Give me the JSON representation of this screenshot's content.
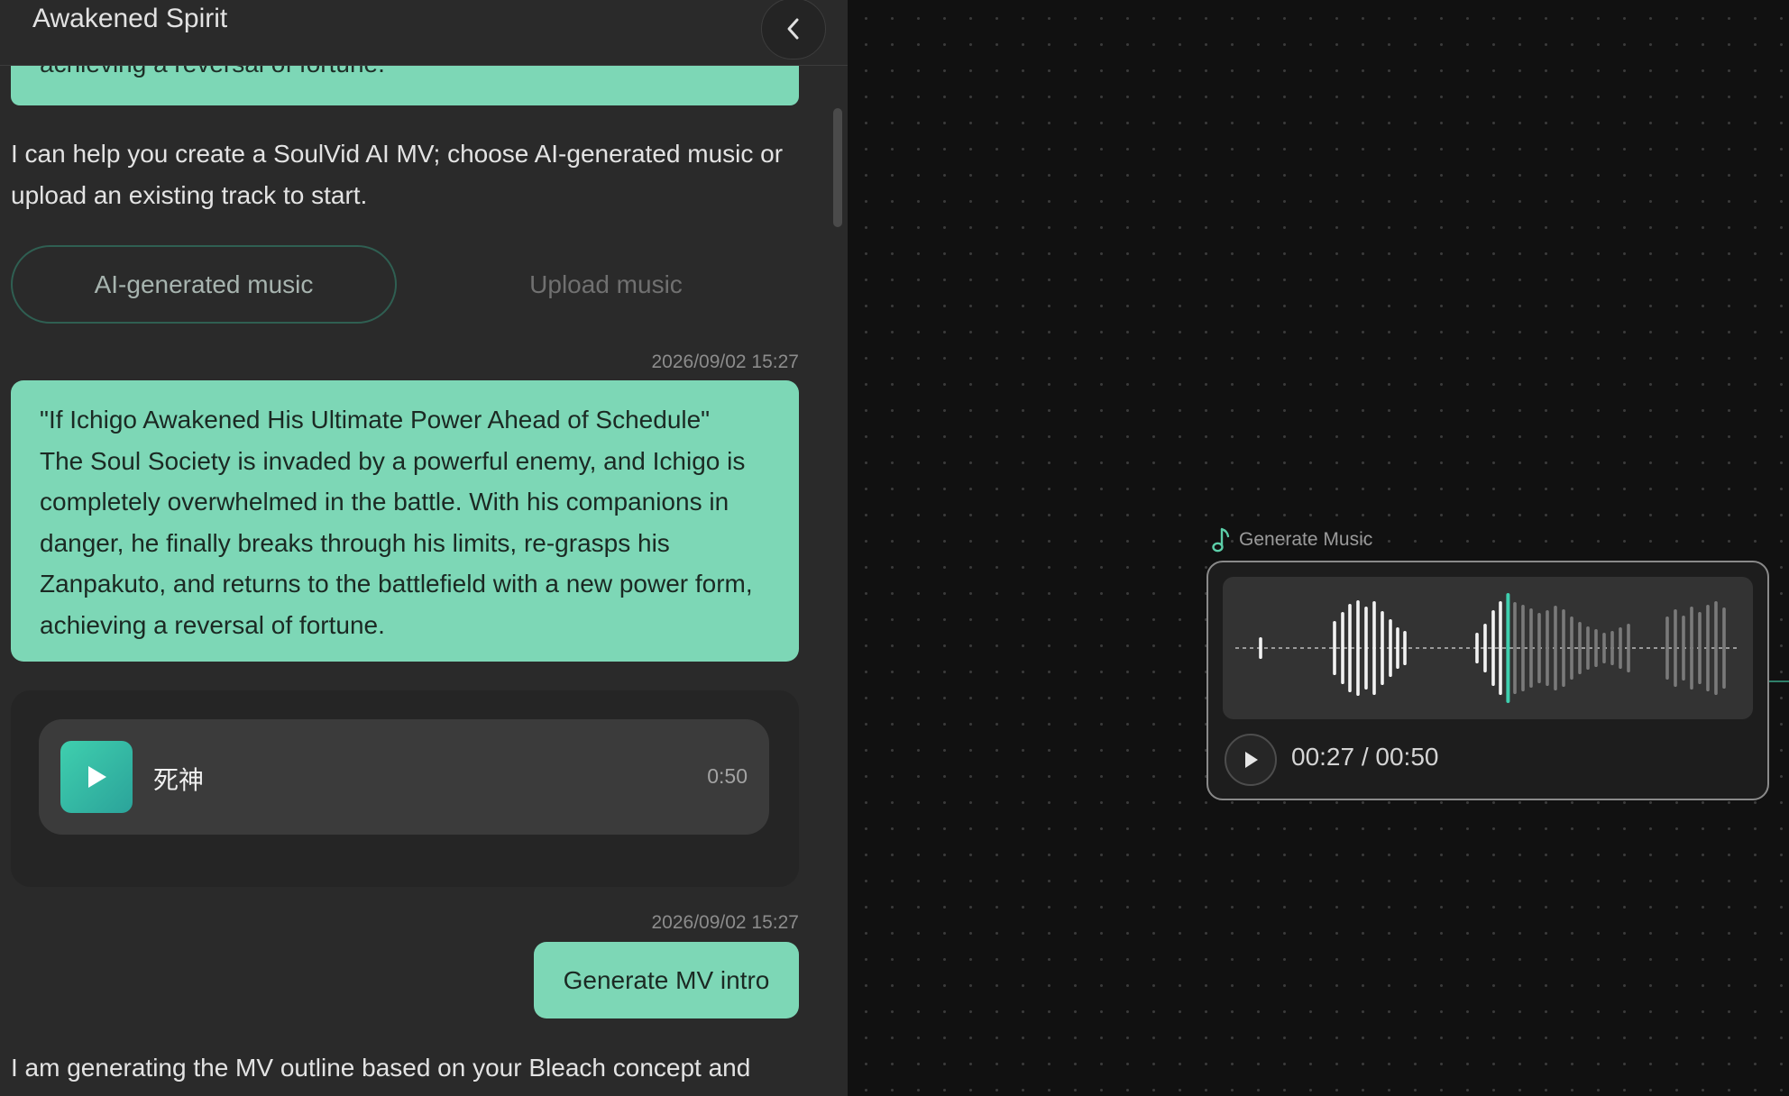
{
  "chat": {
    "title": "Awakened Spirit",
    "collapse_icon": "chevron-left-icon",
    "previous_message_tail": "achieving a reversal of fortune.",
    "assistant_intro": "I can help you create a SoulVid AI MV; choose AI-generated music or upload an existing track to start.",
    "choices": {
      "ai_generated": "AI-generated music",
      "upload": "Upload music"
    },
    "messages": [
      {
        "timestamp": "2026/09/02 15:27",
        "lines": [
          "\"If Ichigo Awakened His Ultimate Power Ahead of Schedule\"",
          "The Soul Society is invaded by a powerful enemy, and Ichigo is completely overwhelmed in the battle. With his companions in danger, he finally breaks through his limits, re-grasps his Zanpakuto, and returns to the battlefield with a new power form, achieving a reversal of fortune."
        ]
      },
      {
        "timestamp": "2026/09/02 15:27",
        "text": "Generate MV intro"
      }
    ],
    "track": {
      "name": "死神",
      "duration": "0:50"
    },
    "assistant_status": "I am generating the MV outline based on your Bleach concept and"
  },
  "canvas": {
    "node": {
      "label": "Generate Music",
      "icon": "music-note-icon",
      "time_current": "00:27",
      "time_total": "00:50",
      "time_display": "00:27 / 00:50",
      "progress_fraction": 0.54
    },
    "colors": {
      "accent": "#7dd7b6",
      "playhead": "#3fcfae",
      "node_border": "#8a8a8a"
    }
  }
}
